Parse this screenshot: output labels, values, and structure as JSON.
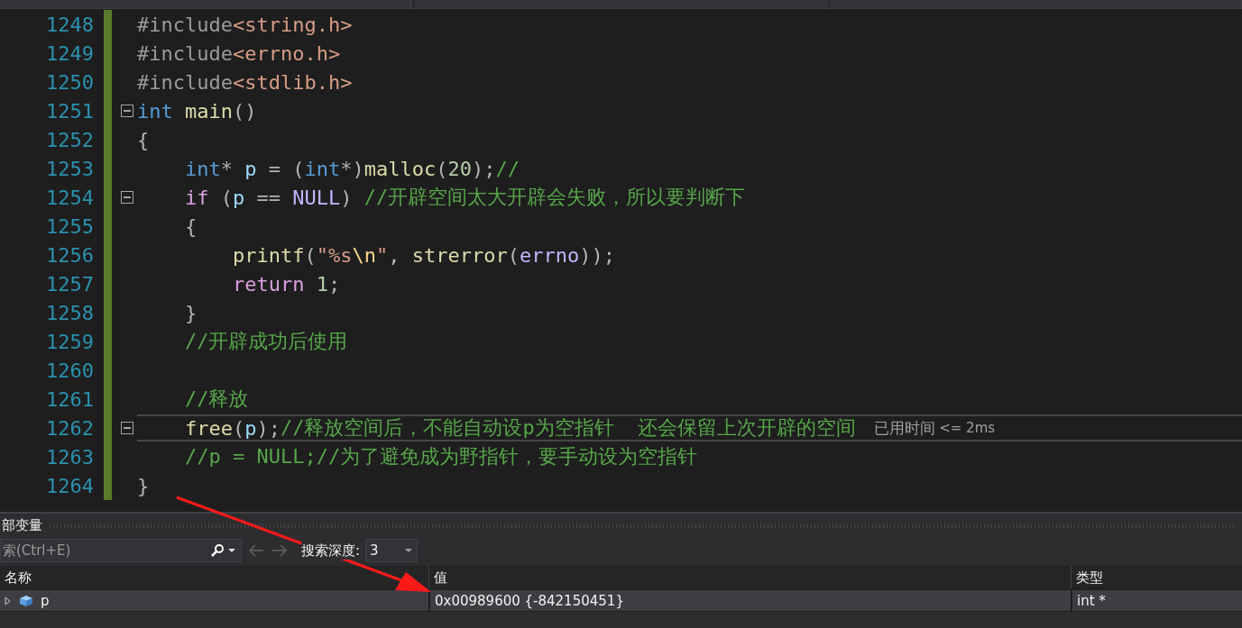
{
  "code_lines": [
    {
      "number": "1248",
      "fold": false,
      "current": false,
      "tokens": [
        {
          "kind": "preproc",
          "text": "#include"
        },
        {
          "kind": "string",
          "text": "<string.h>"
        }
      ]
    },
    {
      "number": "1249",
      "fold": false,
      "current": false,
      "tokens": [
        {
          "kind": "preproc",
          "text": "#include"
        },
        {
          "kind": "string",
          "text": "<errno.h>"
        }
      ]
    },
    {
      "number": "1250",
      "fold": false,
      "current": false,
      "tokens": [
        {
          "kind": "preproc",
          "text": "#include"
        },
        {
          "kind": "string",
          "text": "<stdlib.h>"
        }
      ]
    },
    {
      "number": "1251",
      "fold": true,
      "current": false,
      "tokens": [
        {
          "kind": "keyword",
          "text": "int"
        },
        {
          "kind": "function",
          "text": " main"
        },
        {
          "kind": "punct",
          "text": "()"
        }
      ]
    },
    {
      "number": "1252",
      "fold": false,
      "current": false,
      "tokens": [
        {
          "kind": "punct",
          "text": "{"
        }
      ]
    },
    {
      "number": "1253",
      "fold": false,
      "current": false,
      "tokens": [
        {
          "kind": "keyword",
          "text": "    int"
        },
        {
          "kind": "punct",
          "text": "* "
        },
        {
          "kind": "variable",
          "text": "p"
        },
        {
          "kind": "punct",
          "text": " = ("
        },
        {
          "kind": "keyword",
          "text": "int"
        },
        {
          "kind": "punct",
          "text": "*)"
        },
        {
          "kind": "function",
          "text": "malloc"
        },
        {
          "kind": "punct",
          "text": "("
        },
        {
          "kind": "number",
          "text": "20"
        },
        {
          "kind": "punct",
          "text": ");"
        },
        {
          "kind": "comment",
          "text": "//"
        }
      ]
    },
    {
      "number": "1254",
      "fold": true,
      "current": false,
      "tokens": [
        {
          "kind": "control",
          "text": "    if"
        },
        {
          "kind": "punct",
          "text": " ("
        },
        {
          "kind": "variable",
          "text": "p"
        },
        {
          "kind": "punct",
          "text": " == "
        },
        {
          "kind": "macro",
          "text": "NULL"
        },
        {
          "kind": "punct",
          "text": ") "
        },
        {
          "kind": "comment",
          "text": "//开辟空间太大开辟会失败，所以要判断下"
        }
      ]
    },
    {
      "number": "1255",
      "fold": false,
      "current": false,
      "tokens": [
        {
          "kind": "punct",
          "text": "    {"
        }
      ]
    },
    {
      "number": "1256",
      "fold": false,
      "current": false,
      "tokens": [
        {
          "kind": "function",
          "text": "        printf"
        },
        {
          "kind": "punct",
          "text": "("
        },
        {
          "kind": "string",
          "text": "\"%s"
        },
        {
          "kind": "escape",
          "text": "\\n"
        },
        {
          "kind": "string",
          "text": "\""
        },
        {
          "kind": "punct",
          "text": ", "
        },
        {
          "kind": "function",
          "text": "strerror"
        },
        {
          "kind": "punct",
          "text": "("
        },
        {
          "kind": "macro",
          "text": "errno"
        },
        {
          "kind": "punct",
          "text": "));"
        }
      ]
    },
    {
      "number": "1257",
      "fold": false,
      "current": false,
      "tokens": [
        {
          "kind": "control",
          "text": "        return"
        },
        {
          "kind": "number",
          "text": " 1"
        },
        {
          "kind": "punct",
          "text": ";"
        }
      ]
    },
    {
      "number": "1258",
      "fold": false,
      "current": false,
      "tokens": [
        {
          "kind": "punct",
          "text": "    }"
        }
      ]
    },
    {
      "number": "1259",
      "fold": false,
      "current": false,
      "tokens": [
        {
          "kind": "comment",
          "text": "    //开辟成功后使用"
        }
      ]
    },
    {
      "number": "1260",
      "fold": false,
      "current": false
    },
    {
      "number": "1261",
      "fold": false,
      "current": false,
      "tokens": [
        {
          "kind": "comment",
          "text": "    //释放"
        }
      ]
    },
    {
      "number": "1262",
      "fold": true,
      "current": true,
      "tokens": [
        {
          "kind": "function",
          "text": "    free"
        },
        {
          "kind": "punct",
          "text": "("
        },
        {
          "kind": "variable",
          "text": "p"
        },
        {
          "kind": "punct",
          "text": ");"
        },
        {
          "kind": "comment",
          "text": "//释放空间后，不能自动设p为空指针  还会保留上次开辟的空间"
        }
      ],
      "perf_tip": {
        "label": "已用时间",
        "value": "<= 2ms"
      }
    },
    {
      "number": "1263",
      "fold": false,
      "current": false,
      "tokens": [
        {
          "kind": "comment",
          "text": "    //p = NULL;//为了避免成为野指针，要手动设为空指针"
        }
      ]
    },
    {
      "number": "1264",
      "fold": false,
      "current": false,
      "tokens": [
        {
          "kind": "punct",
          "text": "}"
        }
      ]
    }
  ],
  "locals_panel": {
    "title": "部变量",
    "search": {
      "placeholder": "索(Ctrl+E)"
    },
    "depth_label": "搜索深度:",
    "depth_value": "3",
    "columns": [
      "名称",
      "值",
      "类型"
    ],
    "rows": [
      {
        "name": "p",
        "value": "0x00989600 {-842150451}",
        "type": "int *",
        "expanded": false
      }
    ]
  }
}
